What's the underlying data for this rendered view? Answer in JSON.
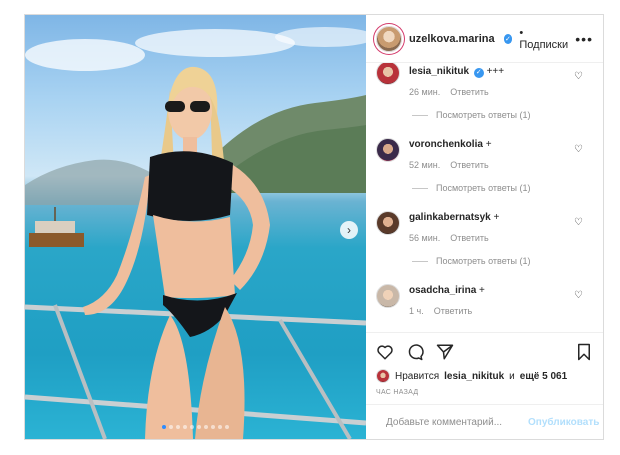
{
  "post": {
    "author": "uzelkova.marina",
    "follow_label": "• Подписки",
    "more_label": "•••",
    "carousel": {
      "current_slide": 1,
      "total_slides": 10,
      "next_glyph": "›"
    }
  },
  "comments": [
    {
      "user": "lesia_nikituk",
      "verified": true,
      "text": "+++",
      "time": "26 мин.",
      "reply_label": "Ответить",
      "view_replies": "Посмотреть ответы (1)"
    },
    {
      "user": "voronchenkolia",
      "verified": false,
      "text": "+",
      "time": "52 мин.",
      "reply_label": "Ответить",
      "view_replies": "Посмотреть ответы (1)"
    },
    {
      "user": "galinkabernatsyk",
      "verified": false,
      "text": "+",
      "time": "56 мин.",
      "reply_label": "Ответить",
      "view_replies": "Посмотреть ответы (1)"
    },
    {
      "user": "osadcha_irina",
      "verified": false,
      "text": "+",
      "time": "1 ч.",
      "reply_label": "Ответить"
    }
  ],
  "likes": {
    "prefix": "Нравится",
    "user": "lesia_nikituk",
    "middle": "и",
    "others": "ещё 5 061"
  },
  "posted_time": "ЧАС НАЗАД",
  "add_comment": {
    "placeholder": "Добавьте комментарий...",
    "publish_label": "Опубликовать"
  },
  "icons": {
    "like": "heart-icon",
    "comment": "comment-bubble-icon",
    "share": "paper-plane-icon",
    "save": "bookmark-icon",
    "emoji": "smiley-icon",
    "verified": "verified-badge-icon"
  },
  "colors": {
    "verified": "#3897f0",
    "publish_disabled": "#b2dffc",
    "secondary_text": "#8e8e8e"
  }
}
